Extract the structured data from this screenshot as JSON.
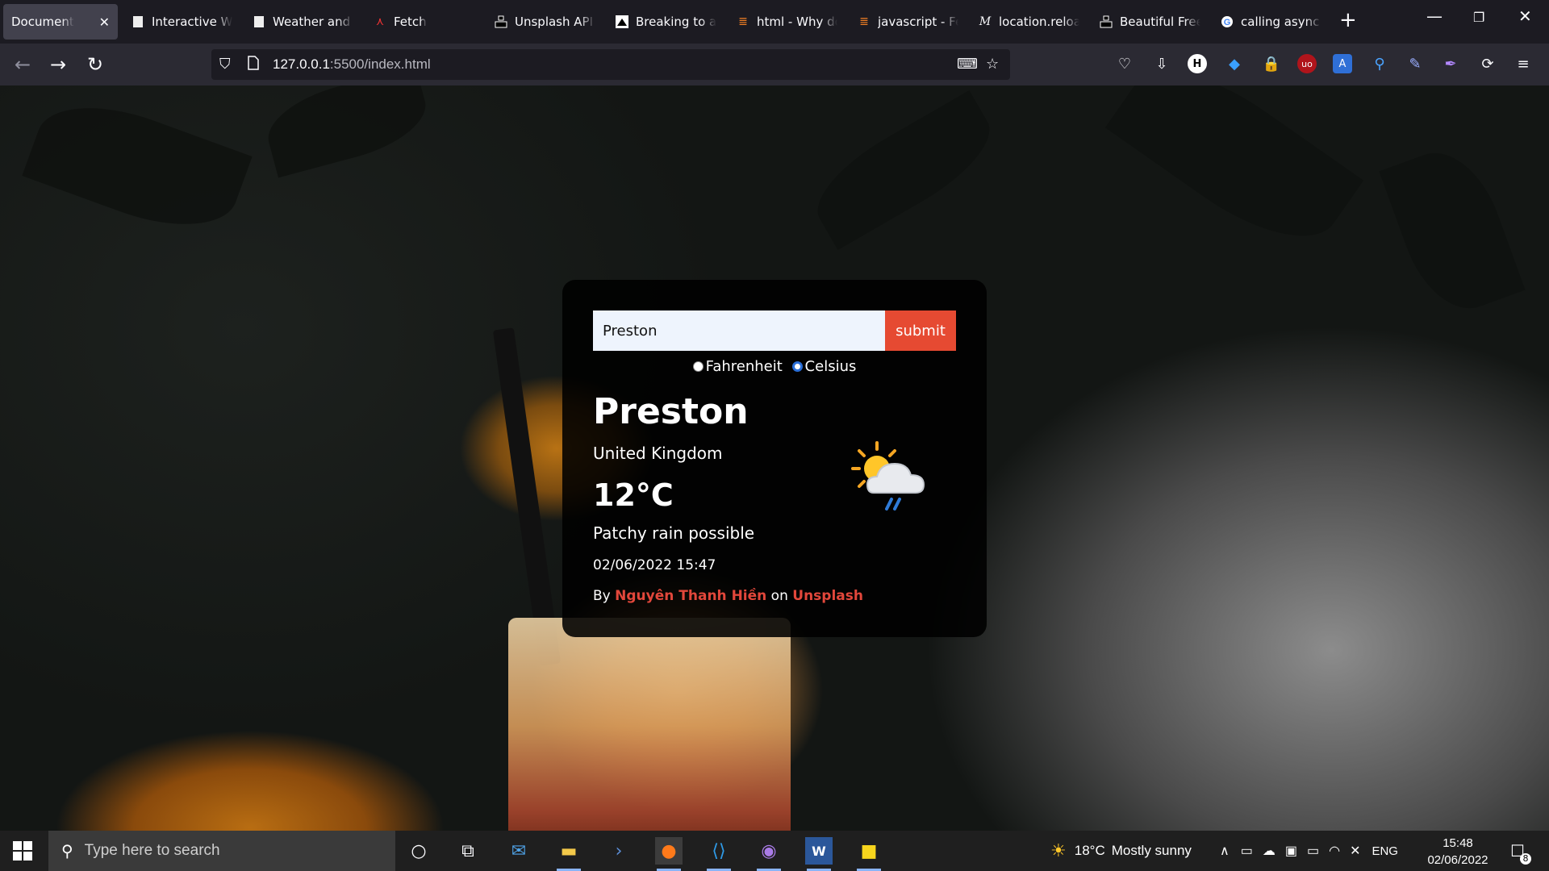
{
  "browser": {
    "tabs": [
      {
        "label": "Document",
        "active": true,
        "icon": "none"
      },
      {
        "label": "Interactive We",
        "icon": "page-icon"
      },
      {
        "label": "Weather and G",
        "icon": "page-icon"
      },
      {
        "label": "Fetch",
        "icon": "fetch-icon"
      },
      {
        "label": "Unsplash API D",
        "icon": "unsplash-icon"
      },
      {
        "label": "Breaking to a r",
        "icon": "zero-to-mastery-icon"
      },
      {
        "label": "html - Why do",
        "icon": "stackoverflow-icon"
      },
      {
        "label": "javascript - Fet",
        "icon": "stackoverflow-icon"
      },
      {
        "label": "location.reload",
        "icon": "mdn-icon"
      },
      {
        "label": "Beautiful Free",
        "icon": "unsplash-icon"
      },
      {
        "label": "calling async fu",
        "icon": "google-icon"
      }
    ],
    "url_host": "127.0.0.1",
    "url_rest": ":5500/index.html"
  },
  "weather_app": {
    "search_value": "Preston",
    "submit_label": "submit",
    "unit_fahrenheit": "Fahrenheit",
    "unit_celsius": "Celsius",
    "selected_unit": "Celsius",
    "city": "Preston",
    "country": "United Kingdom",
    "temperature": "12°C",
    "condition": "Patchy rain possible",
    "datetime": "02/06/2022 15:47",
    "credit_by": "By",
    "photographer": "Nguyên Thanh Hiền",
    "credit_on": "on",
    "source": "Unsplash",
    "weather_icon": "partly-cloudy-rain-icon"
  },
  "taskbar": {
    "search_placeholder": "Type here to search",
    "weather_temp": "18°C",
    "weather_text": "Mostly sunny",
    "language": "ENG",
    "time": "15:48",
    "date": "02/06/2022",
    "notification_count": "8"
  },
  "colors": {
    "accent_red": "#e64a32",
    "link_red": "#e2473b",
    "card_bg": "rgba(0,0,0,0.88)",
    "input_bg": "#eef4fd"
  }
}
